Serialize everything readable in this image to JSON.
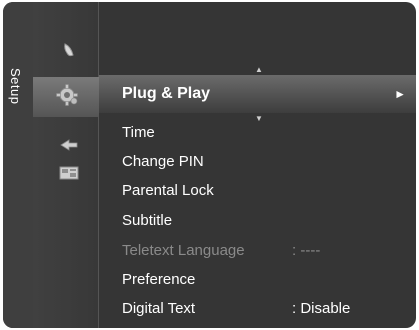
{
  "category": {
    "label": "Setup"
  },
  "icons": [
    {
      "name": "picture-icon"
    },
    {
      "name": "setup-gear-icon"
    },
    {
      "name": "input-icon"
    },
    {
      "name": "application-icon"
    }
  ],
  "menu": {
    "selected": {
      "label": "Plug & Play",
      "arrow": "►"
    },
    "items": [
      {
        "label": "Time",
        "value": ""
      },
      {
        "label": "Change PIN",
        "value": ""
      },
      {
        "label": "Parental Lock",
        "value": ""
      },
      {
        "label": "Subtitle",
        "value": ""
      },
      {
        "label": "Teletext Language",
        "value": ": ----"
      },
      {
        "label": "Preference",
        "value": ""
      },
      {
        "label": "Digital Text",
        "value": ": Disable"
      }
    ]
  },
  "colors": {
    "background": "#353535",
    "selected": "#6b6b6b",
    "text": "#ffffff",
    "disabled_text": "#8a8a8a"
  }
}
